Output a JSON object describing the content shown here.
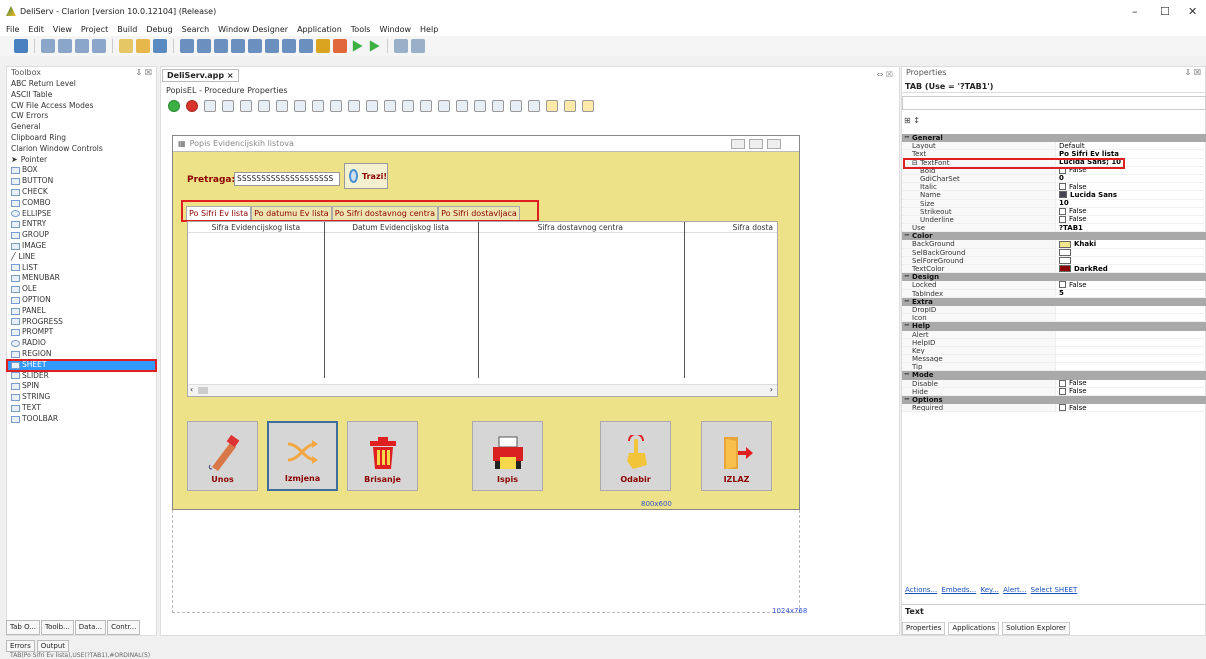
{
  "window": {
    "title": "DeliServ - Clarion [version 10.0.12104] (Release)",
    "controls": [
      "–",
      "☐",
      "✕"
    ]
  },
  "menu": [
    "File",
    "Edit",
    "View",
    "Project",
    "Build",
    "Debug",
    "Search",
    "Window Designer",
    "Application",
    "Tools",
    "Window",
    "Help"
  ],
  "toolbox": {
    "title": "Toolbox",
    "pin": "⇩ ☒",
    "sections": [
      "ABC Return Level",
      "ASCII Table",
      "CW File Access Modes",
      "CW Errors",
      "General",
      "Clipboard Ring",
      "Clarion Window Controls"
    ],
    "items": [
      "Pointer",
      "BOX",
      "BUTTON",
      "CHECK",
      "COMBO",
      "ELLIPSE",
      "ENTRY",
      "GROUP",
      "IMAGE",
      "LINE",
      "LIST",
      "MENUBAR",
      "OLE",
      "OPTION",
      "PANEL",
      "PROGRESS",
      "PROMPT",
      "RADIO",
      "REGION",
      "SHEET",
      "SLIDER",
      "SPIN",
      "STRING",
      "TEXT",
      "TOOLBAR"
    ],
    "selected": "SHEET",
    "bottom_tabs": [
      "Tab O...",
      "Toolb...",
      "Data...",
      "Contr..."
    ],
    "output_tabs": [
      "Errors",
      "Output"
    ]
  },
  "document": {
    "tab": "DeliServ.app ×",
    "procedure": "PopisEL - Procedure Properties",
    "pin": "⇔ ☒"
  },
  "form": {
    "title": "Popis Evidencijskih listova",
    "search_label": "Pretraga:",
    "search_value": "SSSSSSSSSSSSSSSSSSSS",
    "search_button": "Trazi!",
    "tabs": [
      "Po Sifri Ev lista",
      "Po datumu Ev lista",
      "Po Sifri dostavnog centra",
      "Po Sifri dostavljaca"
    ],
    "columns": [
      "Sifra Evidencijskog lista",
      "Datum Evidencijskog lista",
      "Sifra dostavnog centra",
      "Sifra dosta"
    ],
    "buttons": [
      "Unos",
      "Izmjena",
      "Brisanje",
      "Ispis",
      "Odabir",
      "IZLAZ"
    ],
    "dim_small": "800x600",
    "dim_large": "1024x768"
  },
  "properties": {
    "title": "Properties",
    "pin": "⇩ ☒",
    "selected": "TAB (Use = '?TAB1')",
    "sort_icons": "⊞ ↕",
    "groups": [
      {
        "name": "General",
        "rows": [
          {
            "n": "Layout",
            "v": "Default"
          },
          {
            "n": "Text",
            "v": "Po Sifri Ev lista",
            "bold": true
          },
          {
            "n": "⊟ TextFont",
            "v": "Lucida Sans; 10",
            "bold": true
          },
          {
            "n": "Bold",
            "v": "False",
            "chk": true,
            "ind": true
          },
          {
            "n": "GdiCharSet",
            "v": "0",
            "ind": true,
            "bold": true
          },
          {
            "n": "Italic",
            "v": "False",
            "chk": true,
            "ind": true
          },
          {
            "n": "Name",
            "v": "Lucida Sans",
            "ind": true,
            "bold": true,
            "icon": true
          },
          {
            "n": "Size",
            "v": "10",
            "ind": true,
            "bold": true
          },
          {
            "n": "Strikeout",
            "v": "False",
            "chk": true,
            "ind": true
          },
          {
            "n": "Underline",
            "v": "False",
            "chk": true,
            "ind": true
          },
          {
            "n": "Use",
            "v": "?TAB1",
            "bold": true
          }
        ]
      },
      {
        "name": "Color",
        "rows": [
          {
            "n": "BackGround",
            "v": "Khaki",
            "bold": true,
            "swatch": "#f0e68c"
          },
          {
            "n": "SelBackGround",
            "v": "",
            "swatch": "#ffffff"
          },
          {
            "n": "SelForeGround",
            "v": "",
            "swatch": "#ffffff"
          },
          {
            "n": "TextColor",
            "v": "DarkRed",
            "bold": true,
            "swatch": "#8b0000"
          }
        ]
      },
      {
        "name": "Design",
        "rows": [
          {
            "n": "Locked",
            "v": "False",
            "chk": true
          },
          {
            "n": "TabIndex",
            "v": "5",
            "bold": true
          }
        ]
      },
      {
        "name": "Extra",
        "rows": [
          {
            "n": "DropID",
            "v": ""
          },
          {
            "n": "Icon",
            "v": ""
          }
        ]
      },
      {
        "name": "Help",
        "rows": [
          {
            "n": "Alert",
            "v": ""
          },
          {
            "n": "HelpID",
            "v": ""
          },
          {
            "n": "Key",
            "v": ""
          },
          {
            "n": "Message",
            "v": ""
          },
          {
            "n": "Tip",
            "v": ""
          }
        ]
      },
      {
        "name": "Mode",
        "rows": [
          {
            "n": "Disable",
            "v": "False",
            "chk": true
          },
          {
            "n": "Hide",
            "v": "False",
            "chk": true
          }
        ]
      },
      {
        "name": "Options",
        "rows": [
          {
            "n": "Required",
            "v": "False",
            "chk": true
          }
        ]
      }
    ],
    "footer_links": [
      "Actions...",
      "Embeds...",
      "Key...",
      "Alert...",
      "Select SHEET"
    ],
    "description_title": "Text",
    "bottom_tabs": [
      "Properties",
      "Applications",
      "Solution Explorer"
    ]
  },
  "status": "TAB(Po Sifri Ev lista),USE(?TAB1),#ORDINAL(5)"
}
